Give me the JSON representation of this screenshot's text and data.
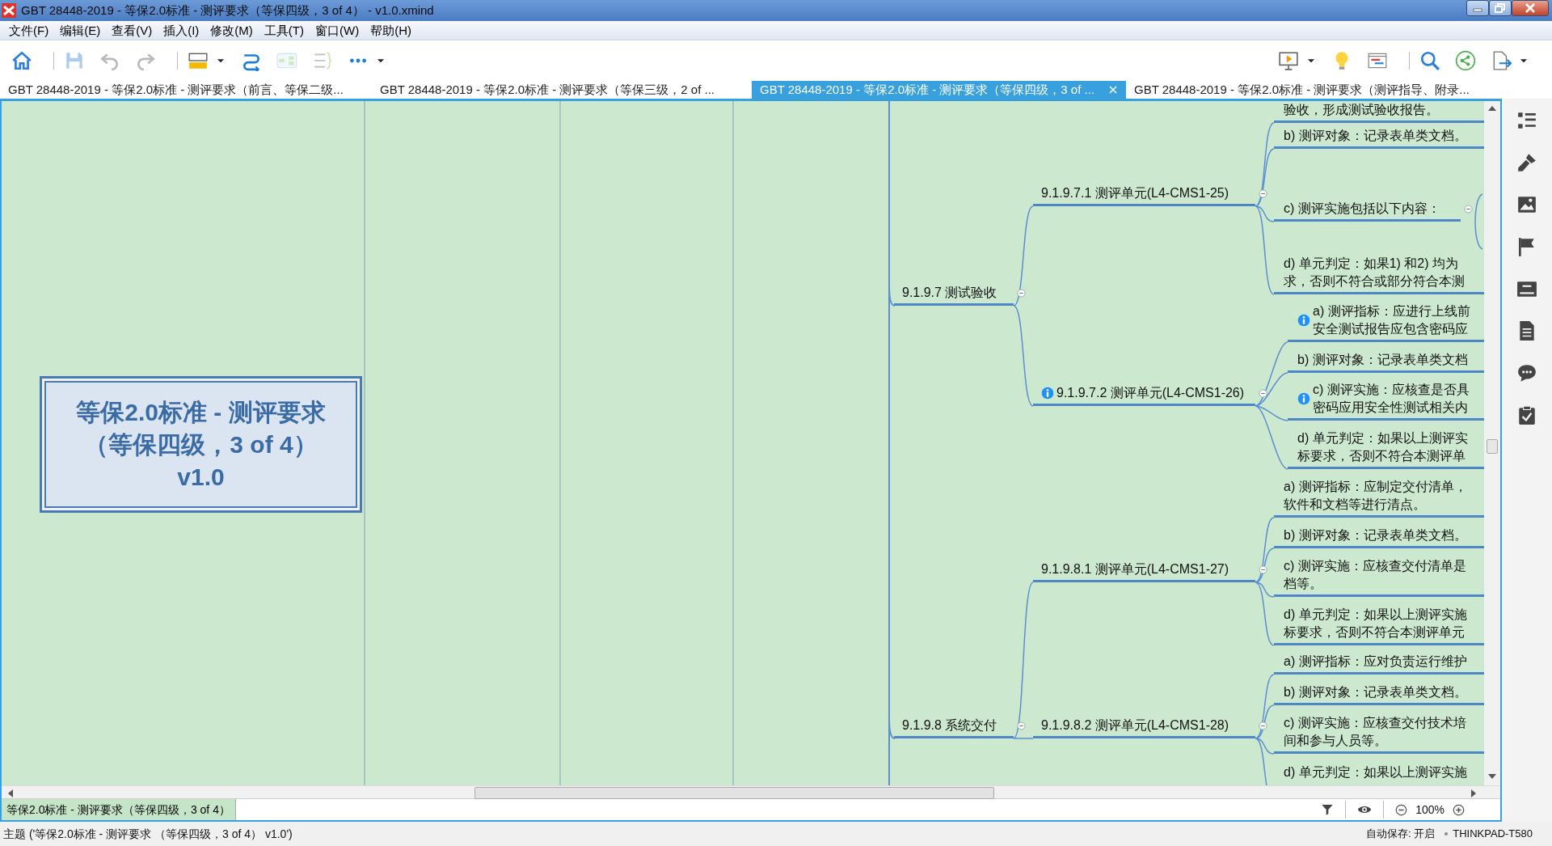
{
  "window": {
    "title": "GBT 28448-2019 - 等保2.0标准 - 测评要求（等保四级，3 of 4） - v1.0.xmind"
  },
  "menu": [
    "文件(F)",
    "编辑(E)",
    "查看(V)",
    "插入(I)",
    "修改(M)",
    "工具(T)",
    "窗口(W)",
    "帮助(H)"
  ],
  "toolbar": {
    "left": [
      [
        {
          "kind": "home",
          "disabled": false
        }
      ],
      [
        {
          "kind": "save",
          "disabled": true
        },
        {
          "kind": "undo",
          "disabled": true
        },
        {
          "kind": "redo",
          "disabled": true
        }
      ],
      [
        {
          "kind": "topic",
          "disabled": false,
          "dropdown": true
        },
        {
          "kind": "relationship",
          "disabled": false
        },
        {
          "kind": "boundary",
          "disabled": true
        },
        {
          "kind": "summary",
          "disabled": true
        },
        {
          "kind": "more",
          "disabled": false,
          "dropdown": true
        }
      ]
    ],
    "right": [
      [
        {
          "kind": "presentation",
          "disabled": false,
          "dropdown": true
        },
        {
          "kind": "bulb",
          "disabled": false
        },
        {
          "kind": "gantt",
          "disabled": false
        }
      ],
      [
        {
          "kind": "search",
          "disabled": false
        },
        {
          "kind": "share",
          "disabled": false
        },
        {
          "kind": "export",
          "disabled": false,
          "dropdown": true
        }
      ]
    ]
  },
  "tabs": [
    {
      "label": "GBT 28448-2019 - 等保2.0标准 - 测评要求（前言、等保二级...",
      "selected": false
    },
    {
      "label": "GBT 28448-2019 - 等保2.0标准 - 测评要求（等保三级，2 of ...",
      "selected": false
    },
    {
      "label": "GBT 28448-2019 - 等保2.0标准 - 测评要求（等保四级，3 of ...",
      "selected": true
    },
    {
      "label": "GBT 28448-2019 - 等保2.0标准 - 测评要求（测评指导、附录...",
      "selected": false
    }
  ],
  "map": {
    "central_topic": {
      "lines": [
        "等保2.0标准 - 测评要求",
        "（等保四级，3 of 4）",
        "v1.0"
      ]
    },
    "branches": [
      {
        "text": "9.1.9.7 测试验收",
        "expanded": true,
        "children": [
          {
            "text": "9.1.9.7.1 测评单元(L4-CMS1-25)",
            "note": false,
            "expanded": true,
            "children": [
              {
                "lines": [
                  "验收，形成测试验收报告。"
                ],
                "note": false
              },
              {
                "lines": [
                  "b) 测评对象：记录表单类文档。"
                ],
                "note": false
              },
              {
                "lines": [
                  "c) 测评实施包括以下内容："
                ],
                "note": false,
                "expanded": true
              },
              {
                "lines": [
                  "d) 单元判定：如果1) 和2) 均为",
                  "求，否则不符合或部分符合本测"
                ],
                "note": false
              }
            ]
          },
          {
            "text": "9.1.9.7.2 测评单元(L4-CMS1-26)",
            "note": true,
            "expanded": true,
            "children": [
              {
                "lines": [
                  "a) 测评指标：应进行上线前",
                  "安全测试报告应包含密码应"
                ],
                "note": true
              },
              {
                "lines": [
                  "b) 测评对象：记录表单类文档"
                ],
                "note": false
              },
              {
                "lines": [
                  "c) 测评实施：应核查是否具",
                  "密码应用安全性测试相关内"
                ],
                "note": true
              },
              {
                "lines": [
                  "d) 单元判定：如果以上测评实",
                  "标要求，否则不符合本测评单"
                ],
                "note": false
              }
            ]
          }
        ]
      },
      {
        "text": "9.1.9.8 系统交付",
        "expanded": true,
        "children": [
          {
            "text": "9.1.9.8.1 测评单元(L4-CMS1-27)",
            "note": false,
            "expanded": true,
            "children": [
              {
                "lines": [
                  "a) 测评指标：应制定交付清单，",
                  "软件和文档等进行清点。"
                ],
                "note": false
              },
              {
                "lines": [
                  "b) 测评对象：记录表单类文档。"
                ],
                "note": false
              },
              {
                "lines": [
                  "c) 测评实施：应核查交付清单是",
                  "档等。"
                ],
                "note": false
              },
              {
                "lines": [
                  "d) 单元判定：如果以上测评实施",
                  "标要求，否则不符合本测评单元"
                ],
                "note": false
              }
            ]
          },
          {
            "text": "9.1.9.8.2 测评单元(L4-CMS1-28)",
            "note": false,
            "expanded": true,
            "children": [
              {
                "lines": [
                  "a) 测评指标：应对负责运行维护"
                ],
                "note": false
              },
              {
                "lines": [
                  "b) 测评对象：记录表单类文档。"
                ],
                "note": false
              },
              {
                "lines": [
                  "c) 测评实施：应核查交付技术培",
                  "间和参与人员等。"
                ],
                "note": false
              },
              {
                "lines": [
                  "d) 单元判定：如果以上测评实施"
                ],
                "note": false
              }
            ]
          }
        ]
      }
    ]
  },
  "side_panel": [
    {
      "kind": "outline"
    },
    {
      "kind": "format"
    },
    {
      "kind": "image"
    },
    {
      "kind": "marker"
    },
    {
      "kind": "font"
    },
    {
      "kind": "notes"
    },
    {
      "kind": "comment"
    },
    {
      "kind": "task"
    }
  ],
  "sheet_tab": "等保2.0标准 - 测评要求（等保四级，3 of 4）",
  "zoom": "100%",
  "status_bar": {
    "selection": "主题 ('等保2.0标准 - 测评要求 （等保四级，3 of 4） v1.0')",
    "autosave": "自动保存: 开启",
    "machine": "THINKPAD-T580"
  }
}
